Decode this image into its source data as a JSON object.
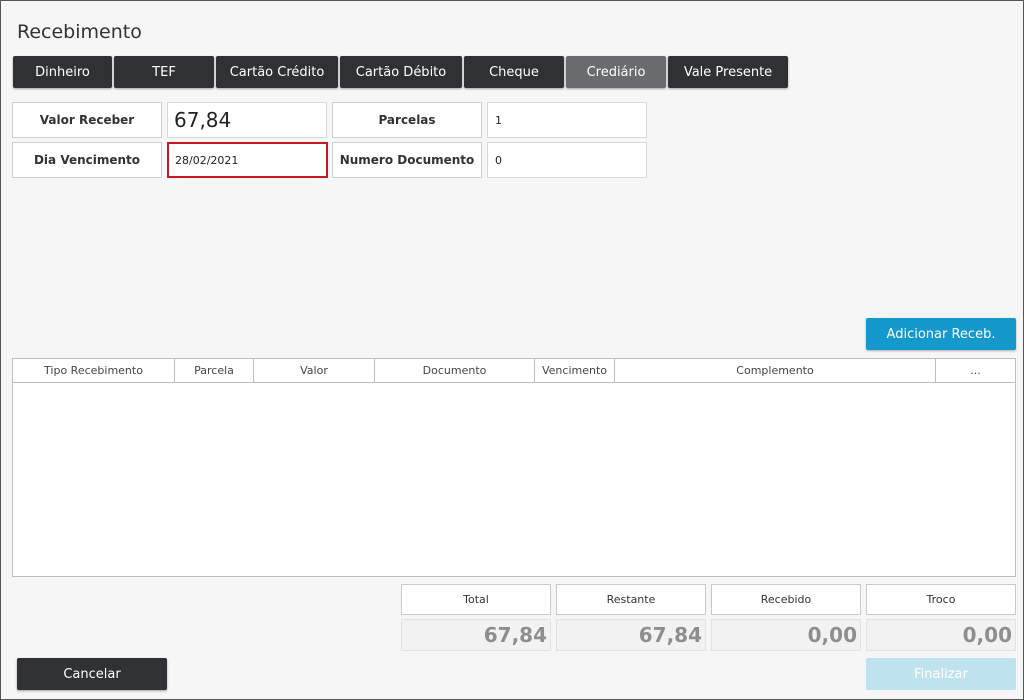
{
  "window": {
    "title": "Recebimento"
  },
  "tabs": [
    {
      "label": "Dinheiro",
      "active": false
    },
    {
      "label": "TEF",
      "active": false
    },
    {
      "label": "Cartão Crédito",
      "active": false
    },
    {
      "label": "Cartão Débito",
      "active": false
    },
    {
      "label": "Cheque",
      "active": false
    },
    {
      "label": "Crediário",
      "active": true
    },
    {
      "label": "Vale Presente",
      "active": false
    }
  ],
  "form": {
    "valor_receber": {
      "label": "Valor Receber",
      "value": "67,84"
    },
    "parcelas": {
      "label": "Parcelas",
      "value": "1"
    },
    "dia_vencimento": {
      "label": "Dia Vencimento",
      "value": "28/02/2021"
    },
    "numero_documento": {
      "label": "Numero Documento",
      "value": "0"
    }
  },
  "add_button": {
    "label": "Adicionar Receb."
  },
  "table": {
    "columns": [
      "Tipo Recebimento",
      "Parcela",
      "Valor",
      "Documento",
      "Vencimento",
      "Complemento",
      "..."
    ],
    "rows": []
  },
  "totals": {
    "total": {
      "label": "Total",
      "value": "67,84"
    },
    "restante": {
      "label": "Restante",
      "value": "67,84"
    },
    "recebido": {
      "label": "Recebido",
      "value": "0,00"
    },
    "troco": {
      "label": "Troco",
      "value": "0,00"
    }
  },
  "actions": {
    "cancel_label": "Cancelar",
    "finalize_label": "Finalizar"
  },
  "colors": {
    "dark_button": "#2f3135",
    "active_tab": "#6a6b6e",
    "accent_blue": "#1599cc",
    "error_border": "#c9171e",
    "disabled_button": "#bfe3ee"
  }
}
